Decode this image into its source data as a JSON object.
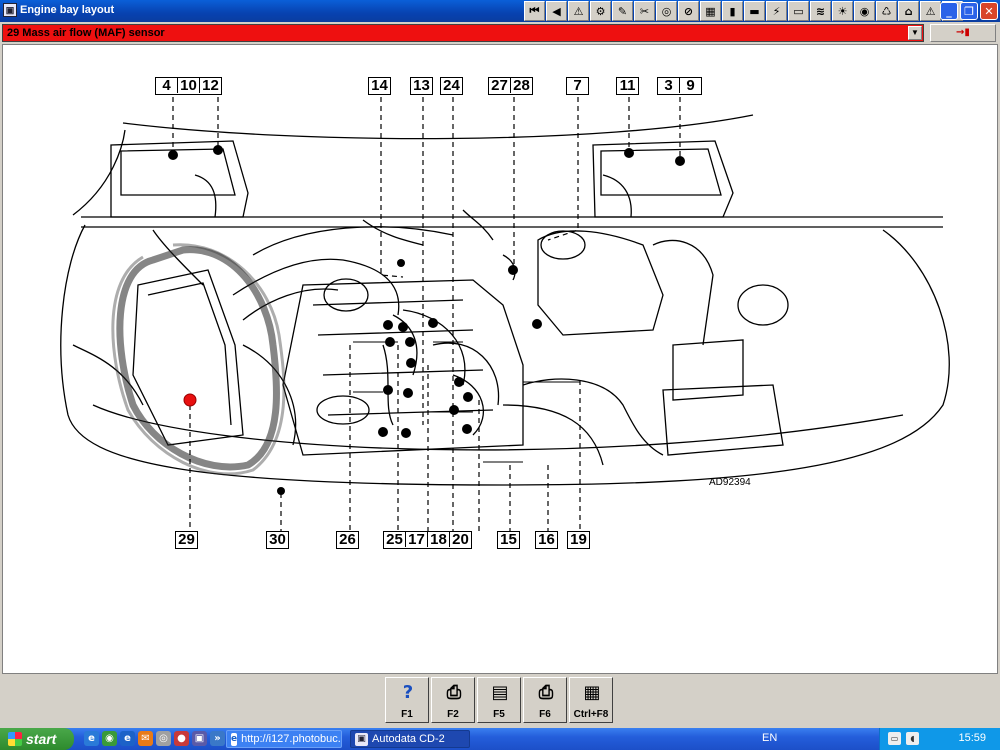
{
  "window": {
    "title": "Engine bay layout",
    "app_icon": "autodata-app-icon"
  },
  "title_toolbar": [
    {
      "name": "first-page-icon",
      "glyph": "⏮"
    },
    {
      "name": "back-icon",
      "glyph": "◀"
    },
    {
      "name": "warning-icon",
      "glyph": "⚠"
    },
    {
      "name": "engine-icon",
      "glyph": "⚙"
    },
    {
      "name": "tools-icon",
      "glyph": "✎"
    },
    {
      "name": "wrench-icon",
      "glyph": "✂"
    },
    {
      "name": "gauge-icon",
      "glyph": "◎"
    },
    {
      "name": "timing-belt-icon",
      "glyph": "⊘"
    },
    {
      "name": "calendar-icon",
      "glyph": "▦"
    },
    {
      "name": "fuel-icon",
      "glyph": "▮"
    },
    {
      "name": "car-icon",
      "glyph": "▬"
    },
    {
      "name": "electrical-icon",
      "glyph": "⚡"
    },
    {
      "name": "battery-icon",
      "glyph": "▭"
    },
    {
      "name": "wiring-icon",
      "glyph": "≋"
    },
    {
      "name": "lamp-icon",
      "glyph": "☀"
    },
    {
      "name": "brake-icon",
      "glyph": "◉"
    },
    {
      "name": "service-icon",
      "glyph": "♺"
    },
    {
      "name": "body-icon",
      "glyph": "⌂"
    },
    {
      "name": "info-icon",
      "glyph": "⚠"
    },
    {
      "name": "vehicle-icon",
      "glyph": "◈"
    }
  ],
  "window_controls": {
    "minimize": "_",
    "maximize": "❐",
    "close": "✕"
  },
  "selector": {
    "value": "29  Mass air flow (MAF) sensor",
    "exit_glyph": "→▮"
  },
  "diagram": {
    "figure_code": "AD92394",
    "callouts_top": [
      [
        "4",
        "10",
        "12"
      ],
      [
        "14"
      ],
      [
        "13"
      ],
      [
        "24"
      ],
      [
        "27",
        "28"
      ],
      [
        "7"
      ],
      [
        "11"
      ],
      [
        "3",
        "9"
      ]
    ],
    "callouts_bottom": [
      [
        "29"
      ],
      [
        "30"
      ],
      [
        "26"
      ],
      [
        "25"
      ],
      [
        "17"
      ],
      [
        "18"
      ],
      [
        "20"
      ],
      [
        "15"
      ],
      [
        "16"
      ],
      [
        "19"
      ]
    ]
  },
  "function_keys": [
    {
      "icon": "help-icon",
      "glyph": "?",
      "key": "F1"
    },
    {
      "icon": "print-preview-icon",
      "glyph": "⎙",
      "key": "F2"
    },
    {
      "icon": "document-icon",
      "glyph": "▤",
      "key": "F5"
    },
    {
      "icon": "printer-icon",
      "glyph": "⎙",
      "key": "F6"
    },
    {
      "icon": "table-icon",
      "glyph": "▦",
      "key": "Ctrl+F8"
    }
  ],
  "taskbar": {
    "start_label": "start",
    "tasks": [
      {
        "label": "http://i127.photobuc...",
        "icon": "internet-explorer-icon"
      },
      {
        "label": "Autodata CD-2",
        "icon": "autodata-app-icon"
      }
    ],
    "tray": {
      "language": "EN",
      "time": "15:59"
    }
  }
}
